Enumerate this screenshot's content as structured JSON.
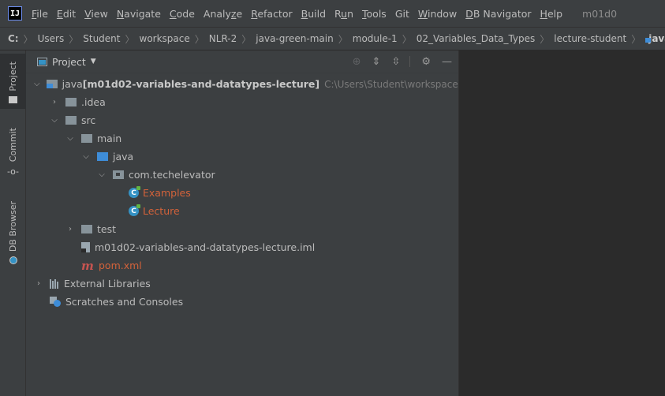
{
  "app": {
    "logo_text": "IJ",
    "window_title": "m01d0"
  },
  "menu": [
    {
      "mnemonic": "F",
      "rest": "ile"
    },
    {
      "mnemonic": "E",
      "rest": "dit"
    },
    {
      "mnemonic": "V",
      "rest": "iew"
    },
    {
      "mnemonic": "N",
      "rest": "avigate"
    },
    {
      "mnemonic": "C",
      "rest": "ode"
    },
    {
      "pre": "Analy",
      "mnemonic": "z",
      "rest": "e"
    },
    {
      "mnemonic": "R",
      "rest": "efactor"
    },
    {
      "mnemonic": "B",
      "rest": "uild"
    },
    {
      "pre": "R",
      "mnemonic": "u",
      "rest": "n"
    },
    {
      "mnemonic": "T",
      "rest": "ools"
    },
    {
      "pre": "Git",
      "mnemonic": "",
      "rest": ""
    },
    {
      "mnemonic": "W",
      "rest": "indow"
    },
    {
      "mnemonic": "D",
      "rest": "B Navigator"
    },
    {
      "mnemonic": "H",
      "rest": "elp"
    }
  ],
  "breadcrumbs": {
    "drive": "C:",
    "items": [
      "Users",
      "Student",
      "workspace",
      "NLR-2",
      "java-green-main",
      "module-1",
      "02_Variables_Data_Types",
      "lecture-student"
    ],
    "last": "java"
  },
  "left_strip": {
    "tabs": [
      "Project",
      "Commit",
      "DB Browser"
    ]
  },
  "project_panel": {
    "title": "Project",
    "tree": [
      {
        "label": "java",
        "bold_suffix": " [m01d02-variables-and-datatypes-lecture]",
        "hint": "C:\\Users\\Student\\workspace\\N"
      },
      {
        "label": ".idea"
      },
      {
        "label": "src"
      },
      {
        "label": "main"
      },
      {
        "label": "java"
      },
      {
        "label": "com.techelevator"
      },
      {
        "label": "Examples"
      },
      {
        "label": "Lecture"
      },
      {
        "label": "test"
      },
      {
        "label": "m01d02-variables-and-datatypes-lecture.iml"
      },
      {
        "label": "pom.xml"
      },
      {
        "label": "External Libraries"
      },
      {
        "label": "Scratches and Consoles"
      }
    ]
  }
}
